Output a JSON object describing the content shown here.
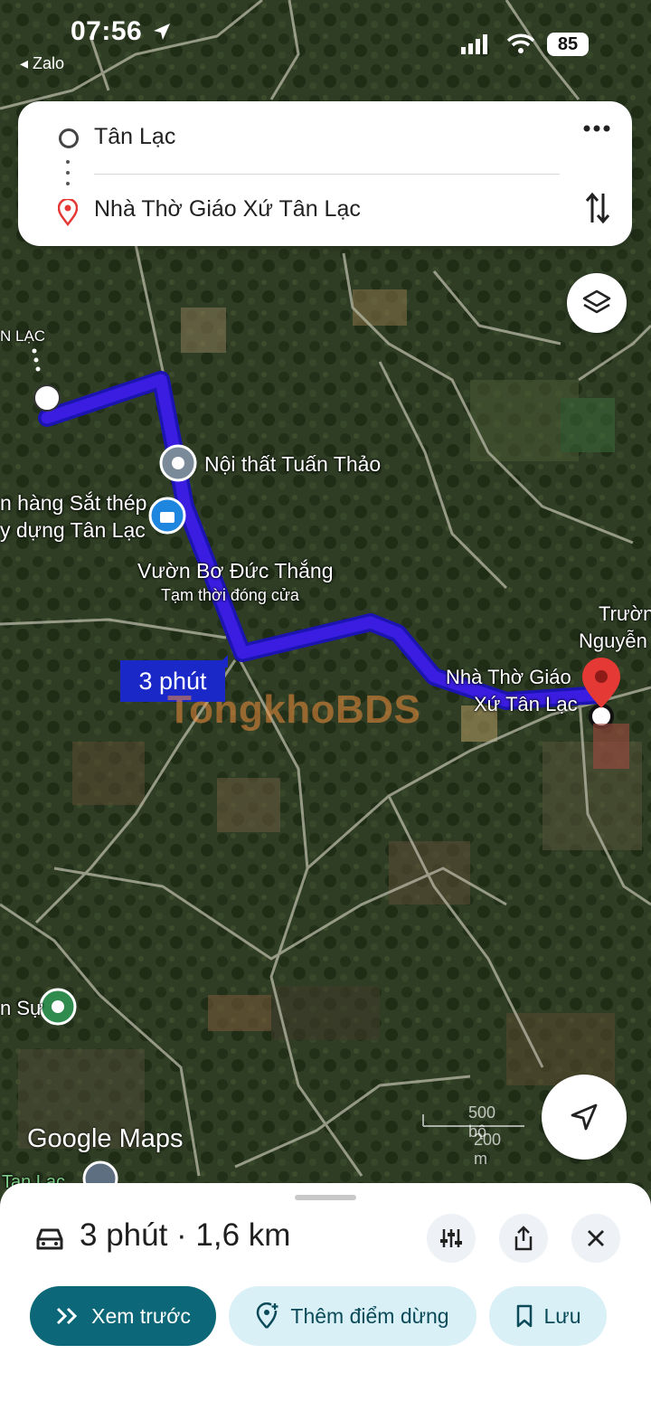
{
  "status_bar": {
    "time": "07:56",
    "back_app": "◂ Zalo",
    "battery": "85"
  },
  "route_card": {
    "origin": "Tân Lạc",
    "destination": "Nhà Thờ Giáo Xứ Tân Lạc"
  },
  "map": {
    "labels": {
      "top_left": "N LẠC",
      "poi_1": "Nội thất Tuấn Thảo",
      "poi_2_line1": "n hàng Sắt thép",
      "poi_2_line2": "y dựng Tân Lạc",
      "poi_3": "Vườn Bơ Đức Thắng",
      "poi_3_status": "Tạm thời đóng cửa",
      "dest_line1": "Nhà Thờ Giáo",
      "dest_line2": "Xứ Tân Lạc",
      "right_line1": "Trườn",
      "right_line2": "Nguyễn",
      "left_bottom": "n Sự",
      "bottom_left": "Tan Lạc"
    },
    "eta_badge": "3 phút",
    "watermark": "TongkhoBDS",
    "attribution": "Google Maps",
    "scale_top": "500 bộ",
    "scale_bottom": "200 m",
    "route_color": "#3a1de0"
  },
  "bottom_sheet": {
    "summary": "3 phút · 1,6 km",
    "preview_label": "Xem trước",
    "add_stop_label": "Thêm điểm dừng",
    "save_label": "Lưu"
  }
}
